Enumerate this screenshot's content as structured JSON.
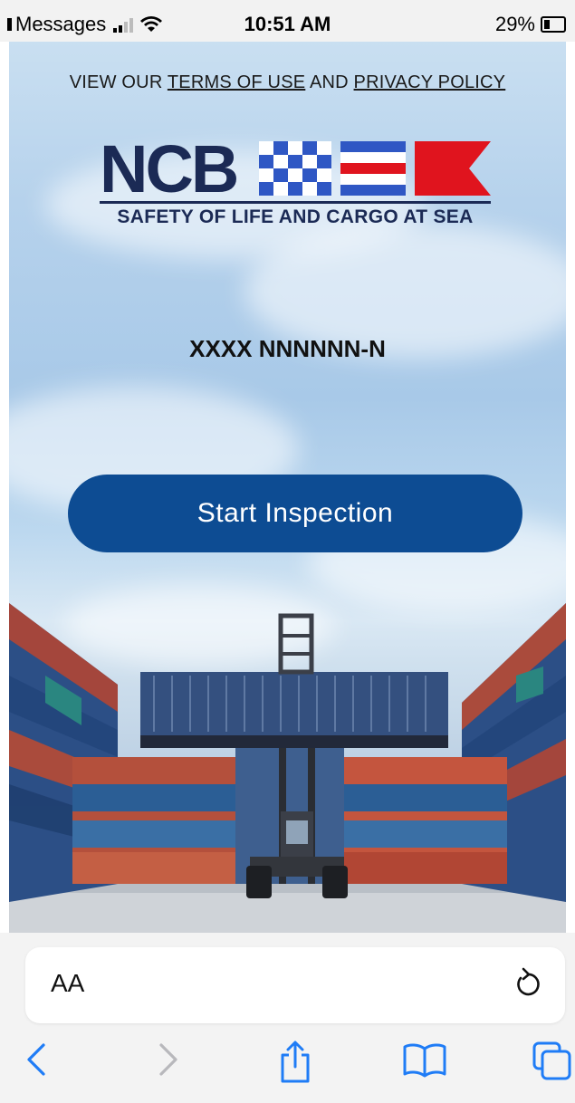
{
  "status_bar": {
    "back_app": "Messages",
    "time": "10:51 AM",
    "battery": "29%",
    "battery_level": 0.29
  },
  "page": {
    "terms_prefix": "VIEW OUR",
    "terms_link": "TERMS OF USE",
    "terms_and": "AND",
    "privacy_link": "PRIVACY POLICY",
    "logo_text": "NCB",
    "logo_tagline": "SAFETY OF LIFE AND CARGO AT SEA",
    "container_code": "XXXX NNNNNN-N",
    "start_button": "Start Inspection"
  },
  "browser": {
    "text_size_label": "AA",
    "icons": [
      "back-icon",
      "forward-icon",
      "share-icon",
      "bookmarks-icon",
      "tabs-icon",
      "reload-icon"
    ]
  },
  "colors": {
    "brand_navy": "#1b2a55",
    "button_blue": "#0d4c93",
    "flag_red": "#e0141e",
    "ios_blue": "#1f7cf6"
  }
}
